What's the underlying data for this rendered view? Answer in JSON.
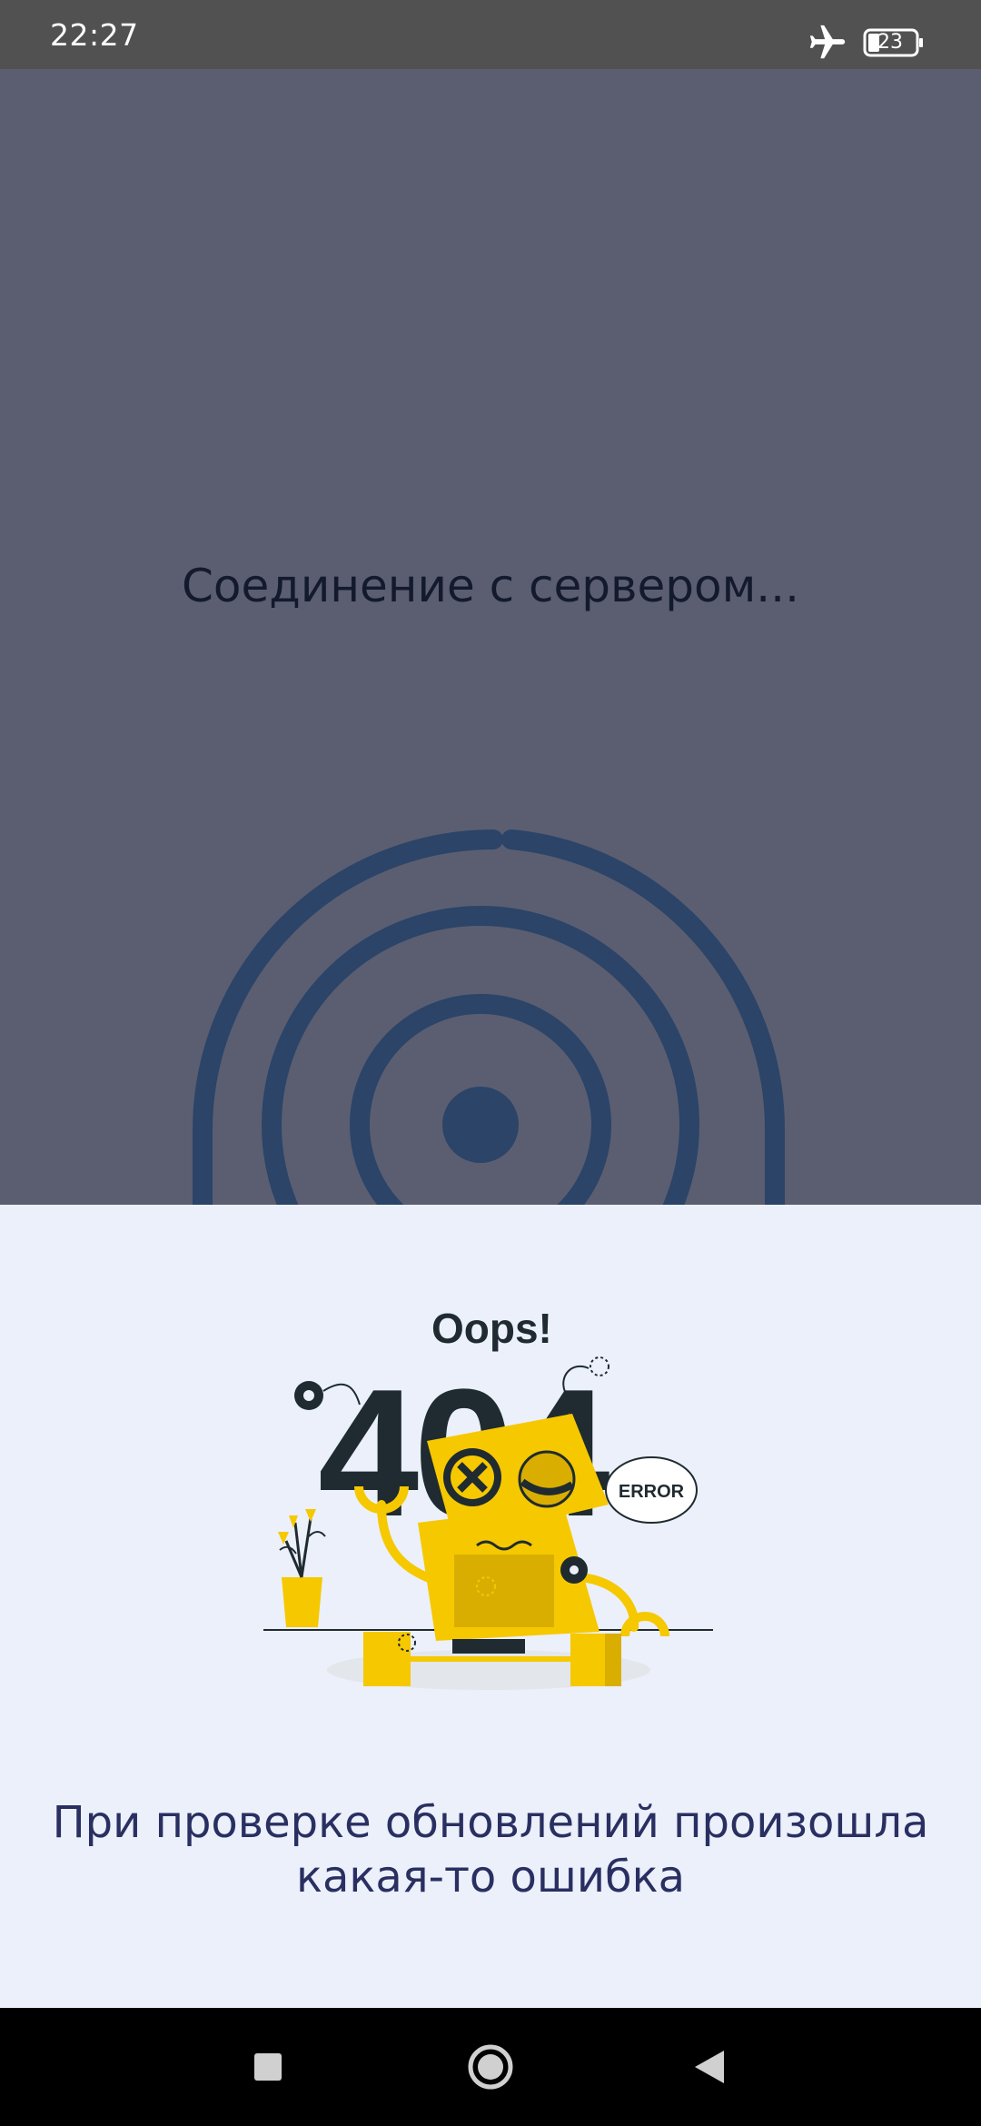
{
  "status_bar": {
    "time": "22:27",
    "battery": "23",
    "airplane_icon": "airplane-icon",
    "battery_icon": "battery-icon"
  },
  "connect": {
    "title": "Соединение с сервером..."
  },
  "error": {
    "oops": "Oops!",
    "code": "404",
    "badge": "ERROR",
    "message": "При проверке обновлений произошла какая-то ошибка"
  },
  "nav": {
    "recents_icon": "square-icon",
    "home_icon": "circle-icon",
    "back_icon": "triangle-back-icon"
  },
  "colors": {
    "status_bar": "#515152",
    "overlay": "#5b5e71",
    "radar": "#2b4468",
    "panel": "#ebf0fa",
    "message": "#2a2f62",
    "robot": "#f6c800"
  }
}
